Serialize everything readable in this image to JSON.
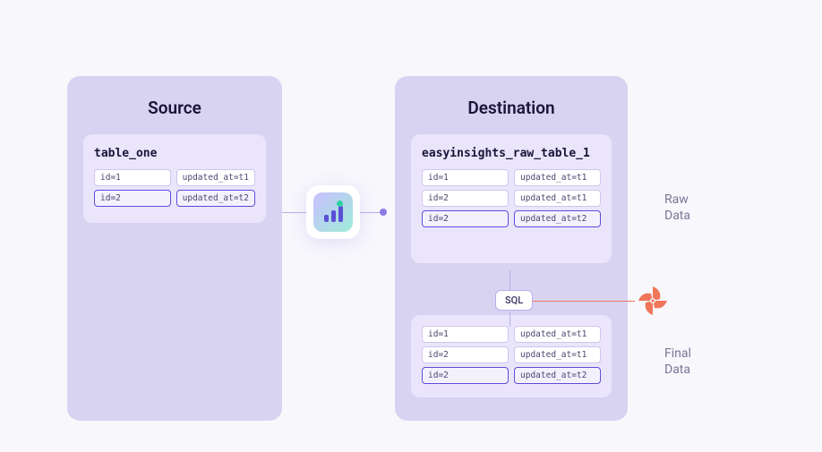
{
  "source": {
    "title": "Source",
    "table": {
      "name": "table_one",
      "rows": [
        {
          "id": "id=1",
          "updated": "updated_at=t1",
          "highlight": false
        },
        {
          "id": "id=2",
          "updated": "updated_at=t2",
          "highlight": true
        }
      ]
    }
  },
  "destination": {
    "title": "Destination",
    "raw_table": {
      "name": "easyinsights_raw_table_1",
      "rows": [
        {
          "id": "id=1",
          "updated": "updated_at=t1",
          "highlight": false
        },
        {
          "id": "id=2",
          "updated": "updated_at=t1",
          "highlight": false
        },
        {
          "id": "id=2",
          "updated": "updated_at=t2",
          "highlight": true
        }
      ]
    },
    "final_table": {
      "rows": [
        {
          "id": "id=1",
          "updated": "updated_at=t1",
          "highlight": false
        },
        {
          "id": "id=2",
          "updated": "updated_at=t1",
          "highlight": false
        },
        {
          "id": "id=2",
          "updated": "updated_at=t2",
          "highlight": true
        }
      ]
    }
  },
  "transform_label": "SQL",
  "labels": {
    "raw": "Raw\nData",
    "final": "Final\nData"
  },
  "colors": {
    "panel": "#d9d3f2",
    "card": "#eae5fb",
    "accent": "#5b4fd6",
    "pinwheel": "#f0765a"
  }
}
